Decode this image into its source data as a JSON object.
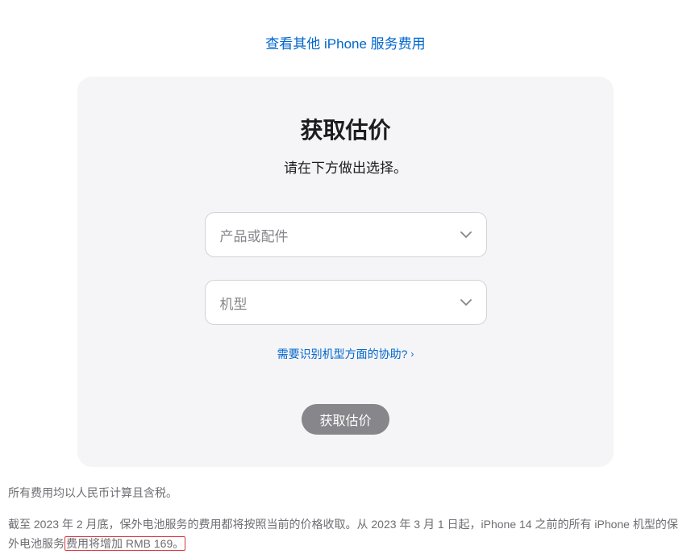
{
  "topLink": {
    "label": "查看其他 iPhone 服务费用"
  },
  "card": {
    "title": "获取估价",
    "subtitle": "请在下方做出选择。",
    "select1Placeholder": "产品或配件",
    "select2Placeholder": "机型",
    "helpLinkLabel": "需要识别机型方面的协助?",
    "submitLabel": "获取估价"
  },
  "footer": {
    "taxNote": "所有费用均以人民币计算且含税。",
    "notice_part1": "截至 2023 年 2 月底，保外电池服务的费用都将按照当前的价格收取。从 2023 年 3 月 1 日起，iPhone 14 之前的所有 iPhone 机型的保外电池服务",
    "notice_highlight": "费用将增加 RMB 169。"
  }
}
